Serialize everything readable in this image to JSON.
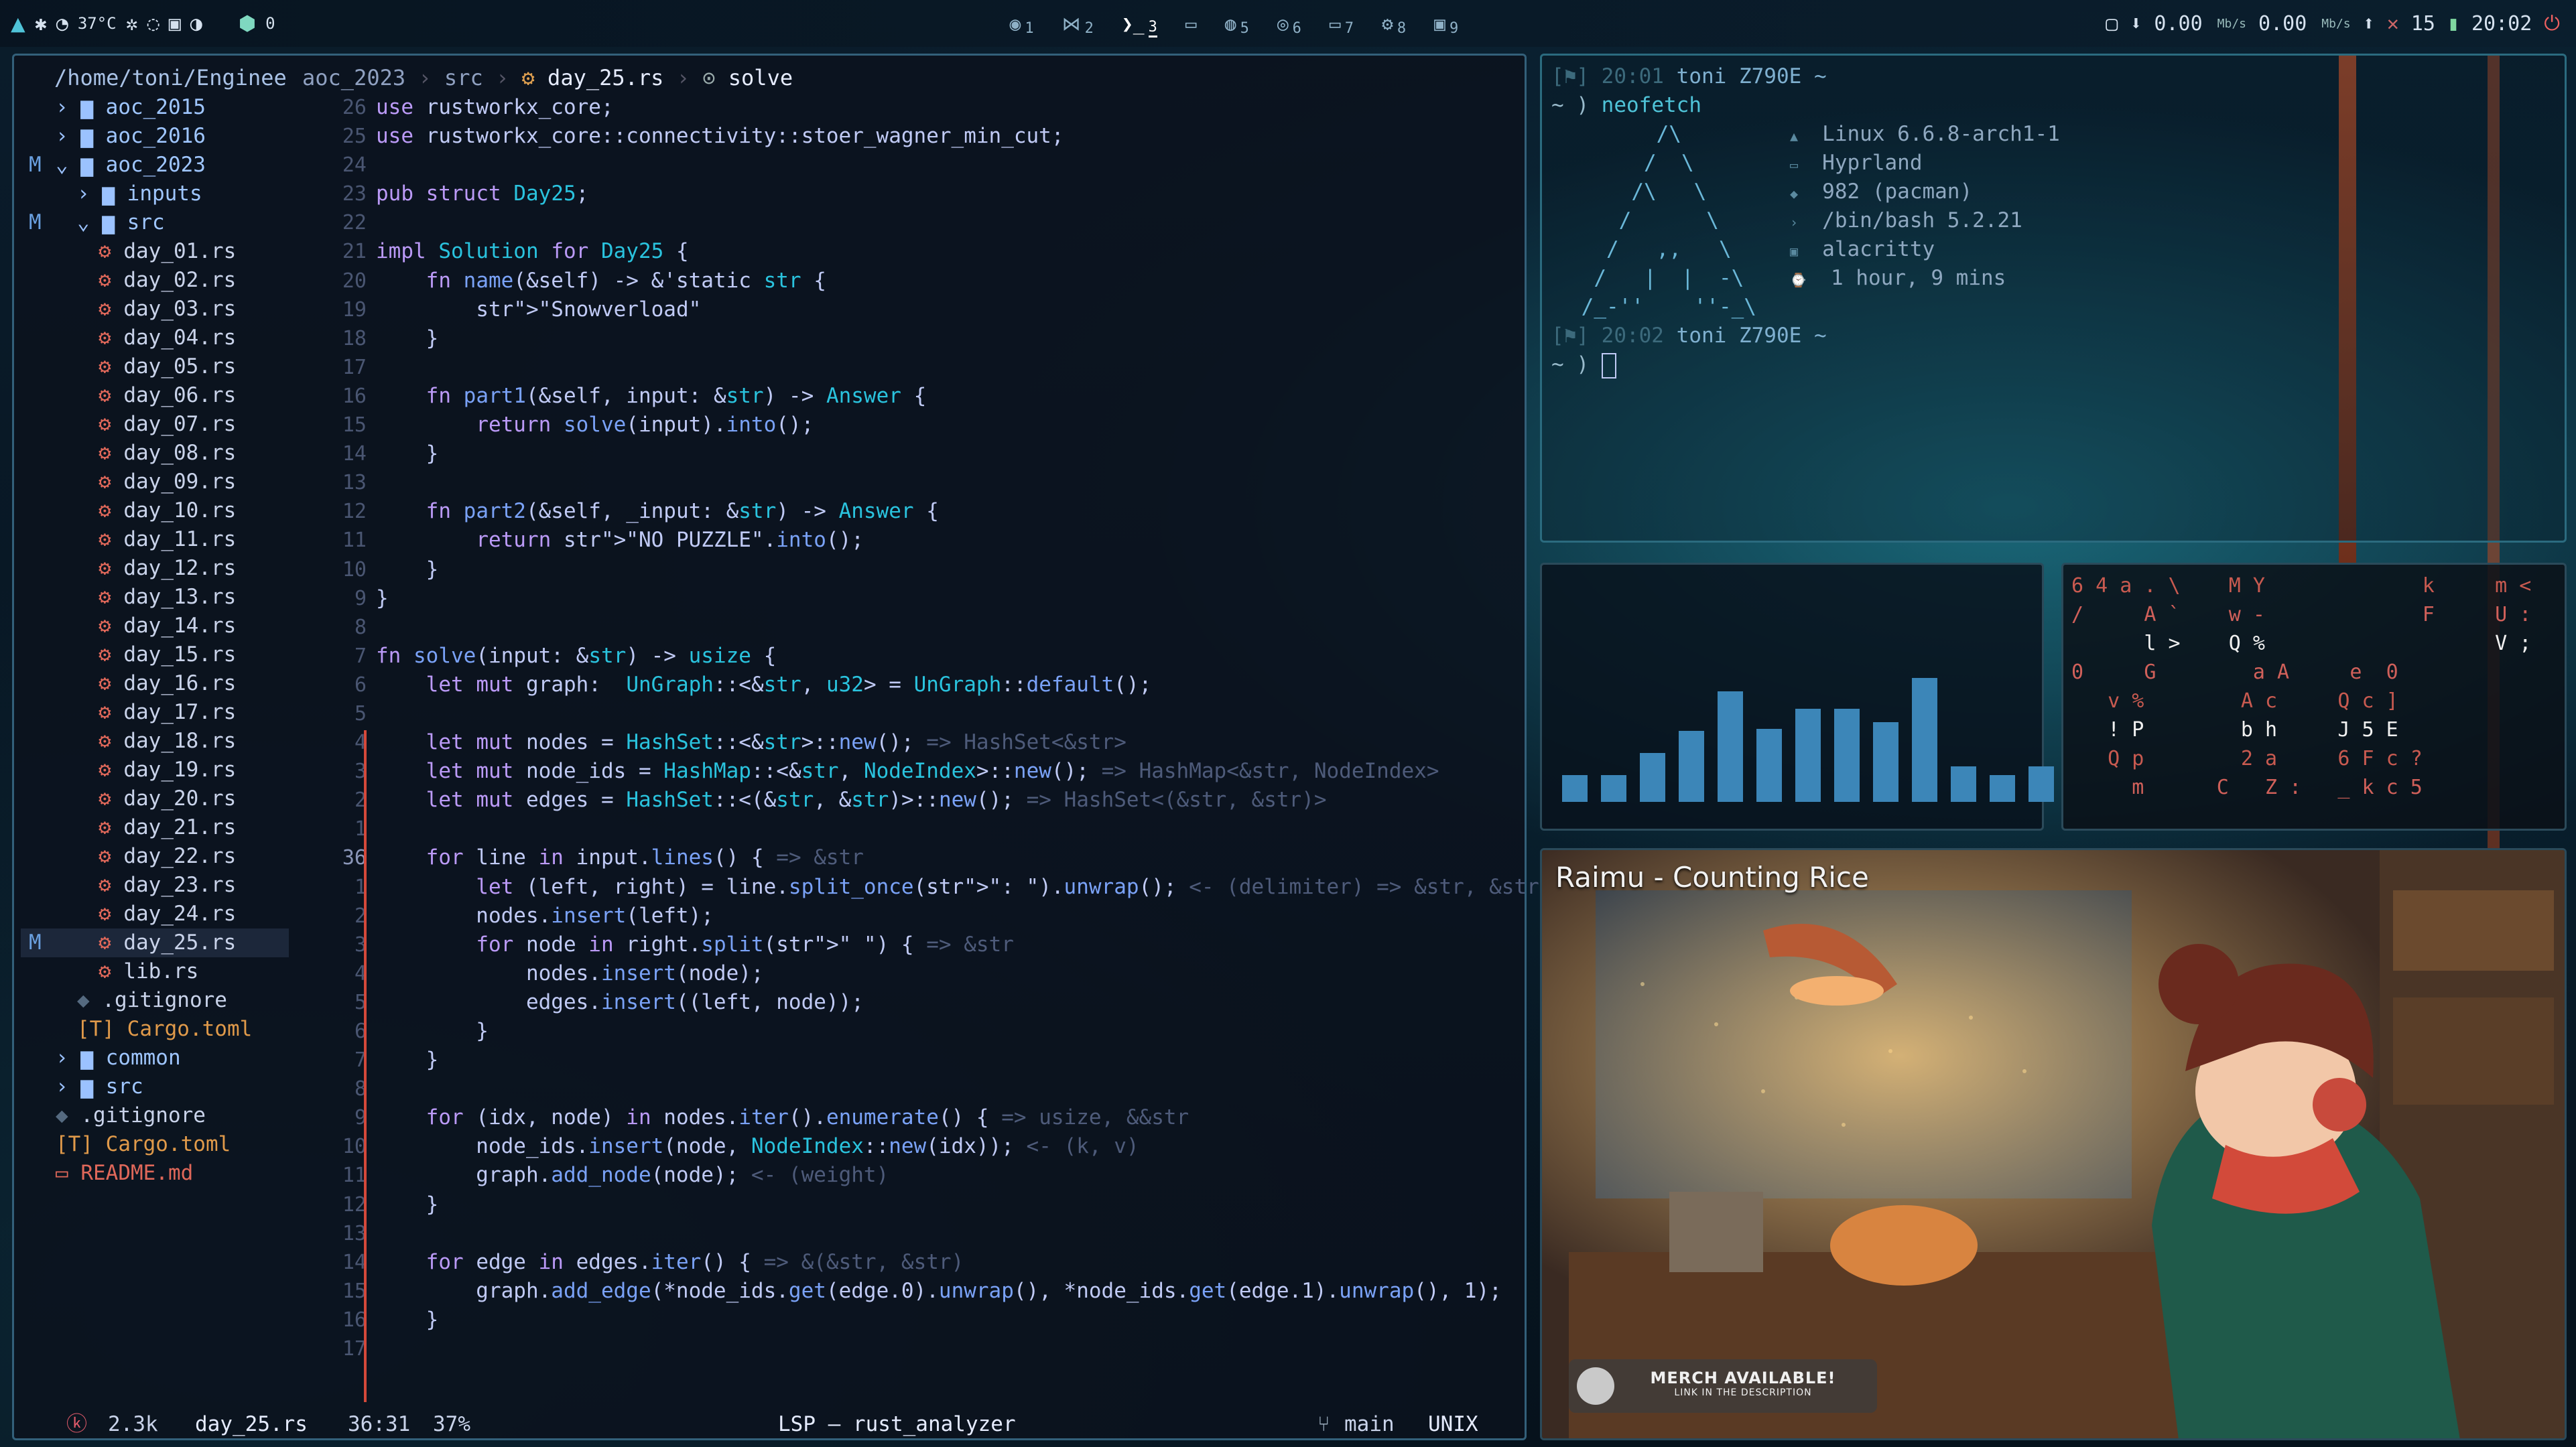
{
  "topbar": {
    "temp": "37°C",
    "update_count": "0",
    "workspaces": [
      {
        "num": "1",
        "active": false
      },
      {
        "num": "2",
        "active": false
      },
      {
        "num": "3",
        "active": true
      },
      {
        "num": "5",
        "active": false
      },
      {
        "num": "6",
        "active": false
      },
      {
        "num": "7",
        "active": false
      },
      {
        "num": "8",
        "active": false
      },
      {
        "num": "9",
        "active": false
      }
    ],
    "net_down": "0.00",
    "net_up": "0.00",
    "net_unit": "Mb/s",
    "battery": "15",
    "clock": "20:02"
  },
  "editor": {
    "root_path": "/home/toni/Enginee",
    "breadcrumb": {
      "dir": "aoc_2023",
      "sub": "src",
      "file": "day_25.rs",
      "symbol": "solve"
    },
    "tree": [
      {
        "label": "aoc_2015",
        "kind": "dir",
        "open": false,
        "depth": 1,
        "git": ""
      },
      {
        "label": "aoc_2016",
        "kind": "dir",
        "open": false,
        "depth": 1,
        "git": ""
      },
      {
        "label": "aoc_2023",
        "kind": "dir",
        "open": true,
        "depth": 1,
        "git": "M"
      },
      {
        "label": "inputs",
        "kind": "dir",
        "open": false,
        "depth": 2,
        "git": ""
      },
      {
        "label": "src",
        "kind": "dir",
        "open": true,
        "depth": 2,
        "git": "M"
      },
      {
        "label": "day_01.rs",
        "kind": "rs",
        "depth": 3,
        "git": ""
      },
      {
        "label": "day_02.rs",
        "kind": "rs",
        "depth": 3,
        "git": ""
      },
      {
        "label": "day_03.rs",
        "kind": "rs",
        "depth": 3,
        "git": ""
      },
      {
        "label": "day_04.rs",
        "kind": "rs",
        "depth": 3,
        "git": ""
      },
      {
        "label": "day_05.rs",
        "kind": "rs",
        "depth": 3,
        "git": ""
      },
      {
        "label": "day_06.rs",
        "kind": "rs",
        "depth": 3,
        "git": ""
      },
      {
        "label": "day_07.rs",
        "kind": "rs",
        "depth": 3,
        "git": ""
      },
      {
        "label": "day_08.rs",
        "kind": "rs",
        "depth": 3,
        "git": ""
      },
      {
        "label": "day_09.rs",
        "kind": "rs",
        "depth": 3,
        "git": ""
      },
      {
        "label": "day_10.rs",
        "kind": "rs",
        "depth": 3,
        "git": ""
      },
      {
        "label": "day_11.rs",
        "kind": "rs",
        "depth": 3,
        "git": ""
      },
      {
        "label": "day_12.rs",
        "kind": "rs",
        "depth": 3,
        "git": ""
      },
      {
        "label": "day_13.rs",
        "kind": "rs",
        "depth": 3,
        "git": ""
      },
      {
        "label": "day_14.rs",
        "kind": "rs",
        "depth": 3,
        "git": ""
      },
      {
        "label": "day_15.rs",
        "kind": "rs",
        "depth": 3,
        "git": ""
      },
      {
        "label": "day_16.rs",
        "kind": "rs",
        "depth": 3,
        "git": ""
      },
      {
        "label": "day_17.rs",
        "kind": "rs",
        "depth": 3,
        "git": ""
      },
      {
        "label": "day_18.rs",
        "kind": "rs",
        "depth": 3,
        "git": ""
      },
      {
        "label": "day_19.rs",
        "kind": "rs",
        "depth": 3,
        "git": ""
      },
      {
        "label": "day_20.rs",
        "kind": "rs",
        "depth": 3,
        "git": ""
      },
      {
        "label": "day_21.rs",
        "kind": "rs",
        "depth": 3,
        "git": ""
      },
      {
        "label": "day_22.rs",
        "kind": "rs",
        "depth": 3,
        "git": ""
      },
      {
        "label": "day_23.rs",
        "kind": "rs",
        "depth": 3,
        "git": ""
      },
      {
        "label": "day_24.rs",
        "kind": "rs",
        "depth": 3,
        "git": ""
      },
      {
        "label": "day_25.rs",
        "kind": "rs",
        "depth": 3,
        "git": "M",
        "selected": true
      },
      {
        "label": "lib.rs",
        "kind": "rs",
        "depth": 3,
        "git": ""
      },
      {
        "label": ".gitignore",
        "kind": "file",
        "depth": 2,
        "git": ""
      },
      {
        "label": "Cargo.toml",
        "kind": "toml",
        "depth": 2,
        "git": ""
      },
      {
        "label": "common",
        "kind": "dir",
        "open": false,
        "depth": 1,
        "git": ""
      },
      {
        "label": "src",
        "kind": "dir",
        "open": false,
        "depth": 1,
        "git": ""
      },
      {
        "label": ".gitignore",
        "kind": "file",
        "depth": 1,
        "git": ""
      },
      {
        "label": "Cargo.toml",
        "kind": "toml",
        "depth": 1,
        "git": ""
      },
      {
        "label": "README.md",
        "kind": "md",
        "depth": 1,
        "git": ""
      }
    ],
    "line_numbers": [
      "26",
      "25",
      "24",
      "23",
      "22",
      "21",
      "20",
      "19",
      "18",
      "17",
      "16",
      "15",
      "14",
      "13",
      "12",
      "11",
      "10",
      "9",
      "8",
      "7",
      "6",
      "5",
      "4",
      "3",
      "2",
      "1",
      "36",
      "1",
      "2",
      "3",
      "4",
      "5",
      "6",
      "7",
      "8",
      "9",
      "10",
      "11",
      "12",
      "13",
      "14",
      "15",
      "16",
      "17"
    ],
    "code": [
      "use rustworkx_core;",
      "use rustworkx_core::connectivity::stoer_wagner_min_cut;",
      "",
      "pub struct Day25;",
      "",
      "impl Solution for Day25 {",
      "    fn name(&self) -> &'static str {",
      "        \"Snowverload\"",
      "    }",
      "",
      "    fn part1(&self, input: &str) -> Answer {",
      "        return solve(input).into();",
      "    }",
      "",
      "    fn part2(&self, _input: &str) -> Answer {",
      "        return \"NO PUZZLE\".into();",
      "    }",
      "}",
      "",
      "fn solve(input: &str) -> usize {",
      "    let mut graph:  UnGraph::<&str, u32> = UnGraph::default();",
      "",
      "    let mut nodes = HashSet::<&str>::new(); => HashSet<&str>",
      "    let mut node_ids = HashMap::<&str, NodeIndex>::new(); => HashMap<&str, NodeIndex>",
      "    let mut edges = HashSet::<(&str, &str)>::new(); => HashSet<(&str, &str)>",
      "",
      "    for line in input.lines() { => &str",
      "        let (left, right) = line.split_once(\": \").unwrap(); <- (delimiter) => &str, &str",
      "        nodes.insert(left);",
      "        for node in right.split(\" \") { => &str",
      "            nodes.insert(node);",
      "            edges.insert((left, node));",
      "        }",
      "    }",
      "",
      "    for (idx, node) in nodes.iter().enumerate() { => usize, &&str",
      "        node_ids.insert(node, NodeIndex::new(idx)); <- (k, v)",
      "        graph.add_node(node); <- (weight)",
      "    }",
      "",
      "    for edge in edges.iter() { => &(&str, &str)",
      "        graph.add_edge(*node_ids.get(edge.0).unwrap(), *node_ids.get(edge.1).unwrap(), 1);",
      "    }",
      ""
    ],
    "status": {
      "size": "2.3k",
      "file": "day_25.rs",
      "position": "36:31",
      "percent": "37%",
      "lsp": "LSP — rust_analyzer",
      "branch": "main",
      "format": "UNIX"
    }
  },
  "terminal": {
    "prompt1_time": "20:01",
    "prompt2_time": "20:02",
    "user_host": "toni Z790E ~",
    "command": "neofetch",
    "prompt_symbol": "~ )",
    "ascii": [
      "       /\\",
      "      /  \\",
      "     /\\   \\",
      "    /      \\",
      "   /   ,,   \\",
      "  /   |  |  -\\",
      " /_-''    ''-_\\"
    ],
    "info": [
      "Linux 6.6.8-arch1-1",
      "Hyprland",
      "982 (pacman)",
      "/bin/bash 5.2.21",
      "alacritty",
      "1 hour, 9 mins"
    ]
  },
  "cava": {
    "levels": [
      0.12,
      0.12,
      0.22,
      0.32,
      0.5,
      0.33,
      0.42,
      0.42,
      0.36,
      0.56,
      0.16,
      0.12,
      0.16
    ]
  },
  "matrix": {
    "lines": [
      "6 4 a . \\    M Y             k     m <",
      "/     A `    w -             F     U :",
      "      l >    Q %                   V ;",
      "0     G        a A     e  0",
      "   v %        A c     Q c ]",
      "   ! P        b h     J 5 E",
      "   Q p        2 a     6 F c ?",
      "     m      C   Z :   _ k c 5"
    ]
  },
  "video": {
    "title": "Raimu - Counting Rice",
    "merch": "MERCH AVAILABLE!",
    "merch_sub": "LINK IN THE DESCRIPTION"
  }
}
